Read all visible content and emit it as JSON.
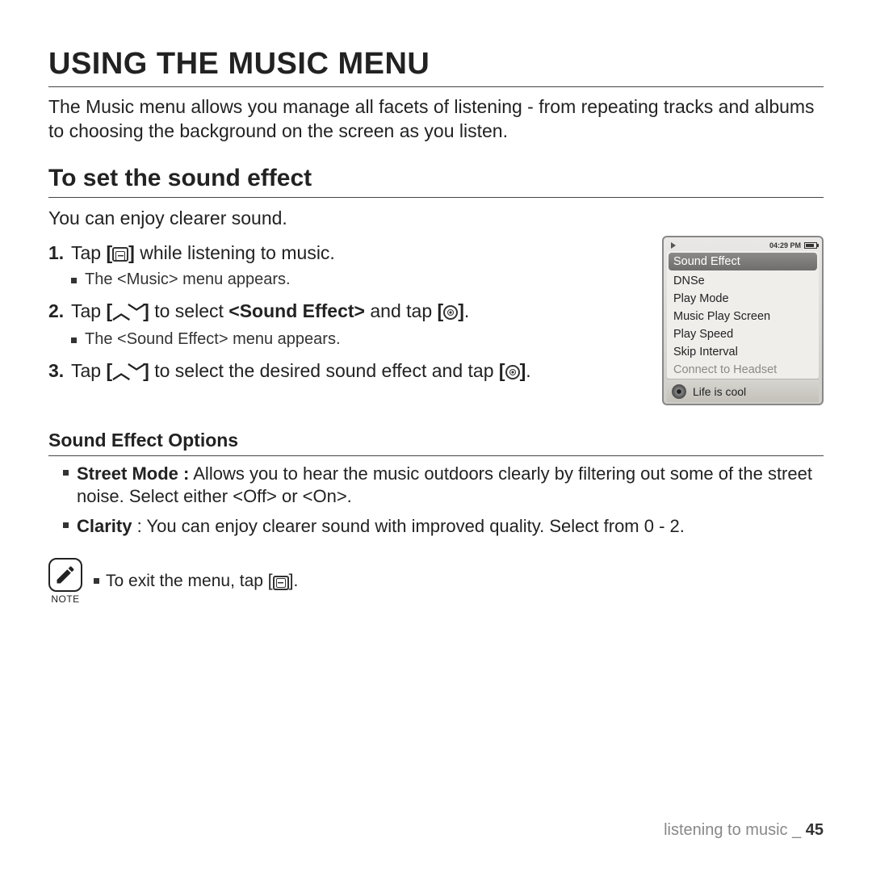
{
  "title": "USING THE MUSIC MENU",
  "intro": "The Music menu allows you manage all facets of listening - from repeating tracks and albums to choosing the background on the screen as you listen.",
  "sub_heading": "To set the sound effect",
  "sub_intro": "You can enjoy clearer sound.",
  "steps": {
    "s1": {
      "num": "1.",
      "a": "Tap ",
      "b": " while listening to music."
    },
    "s1_sub": "The <Music> menu appears.",
    "s2": {
      "num": "2.",
      "a": "Tap ",
      "b": " to select ",
      "bold": "<Sound Effect>",
      "c": " and tap ",
      "d": "."
    },
    "s2_sub": "The <Sound Effect> menu appears.",
    "s3": {
      "num": "3.",
      "a": "Tap ",
      "b": " to select the desired sound effect and tap ",
      "c": "."
    }
  },
  "options_heading": "Sound Effect Options",
  "options": {
    "o1_bold": "Street Mode :",
    "o1_text": " Allows you to hear the music outdoors clearly by  filtering out some of the street noise. Select either <Off> or <On>.",
    "o2_bold": "Clarity",
    "o2_text": " : You can enjoy clearer sound with improved quality. Select from 0 - 2."
  },
  "note_label": "NOTE",
  "note_text_a": "To exit the menu, tap ",
  "note_text_b": ".",
  "device": {
    "time": "04:29 PM",
    "items": [
      "Sound Effect",
      "DNSe",
      "Play Mode",
      "Music Play Screen",
      "Play Speed",
      "Skip Interval",
      "Connect to Headset"
    ],
    "nowplaying": "Life is cool"
  },
  "footer": {
    "section": "listening to music _ ",
    "page": "45"
  }
}
